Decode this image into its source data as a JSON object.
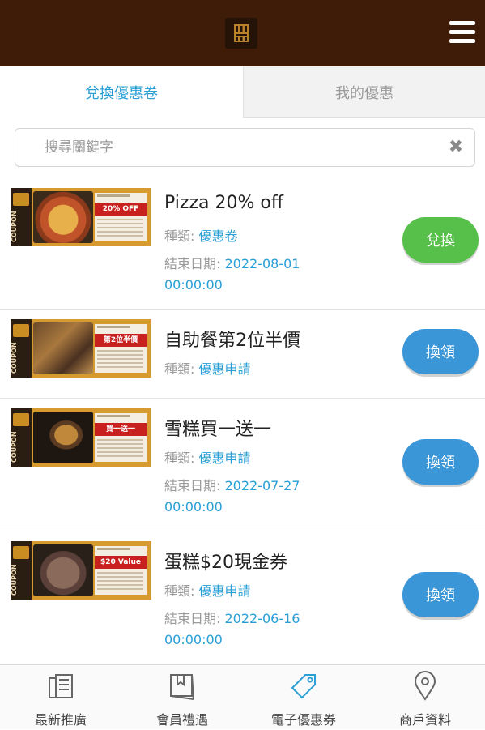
{
  "header": {
    "logo_icon": "wheat-logo-icon",
    "menu_icon": "hamburger-menu-icon",
    "bg_color": "#3e1c08"
  },
  "tabs": [
    {
      "label": "兌換優惠卷",
      "active": true
    },
    {
      "label": "我的優惠",
      "active": false
    }
  ],
  "search": {
    "placeholder": "搜尋關鍵字",
    "value": "",
    "clear_icon": "clear-x-icon"
  },
  "coupons": [
    {
      "title": "Pizza 20% off",
      "type_label": "種類:",
      "type_value": "優惠卷",
      "end_label": "結束日期:",
      "end_date": "2022-08-01",
      "end_time": "00:00:00",
      "button": "兌換",
      "button_color": "#57c04a",
      "thumb_text": "20% OFF"
    },
    {
      "title": "自助餐第2位半價",
      "type_label": "種類:",
      "type_value": "優惠申請",
      "button": "換領",
      "button_color": "#3a96d6",
      "thumb_text": "第2位半價"
    },
    {
      "title": "雪糕買一送一",
      "type_label": "種類:",
      "type_value": "優惠申請",
      "end_label": "結束日期:",
      "end_date": "2022-07-27",
      "end_time": "00:00:00",
      "button": "換領",
      "button_color": "#3a96d6",
      "thumb_text": "買一送一"
    },
    {
      "title": "蛋糕$20現金券",
      "type_label": "種類:",
      "type_value": "優惠申請",
      "end_label": "結束日期:",
      "end_date": "2022-06-16",
      "end_time": "00:00:00",
      "button": "換領",
      "button_color": "#3a96d6",
      "thumb_text": "$20 Value"
    }
  ],
  "thumb_common": {
    "coupon_word": "COUPON"
  },
  "bottom_nav": [
    {
      "label": "最新推廣",
      "icon": "news-icon"
    },
    {
      "label": "會員禮遇",
      "icon": "book-icon"
    },
    {
      "label": "電子優惠券",
      "icon": "tag-icon",
      "active": true
    },
    {
      "label": "商戶資料",
      "icon": "location-pin-icon"
    }
  ],
  "colors": {
    "accent": "#2a9fd6",
    "green": "#57c04a",
    "blue": "#3a96d6",
    "header": "#3e1c08"
  }
}
